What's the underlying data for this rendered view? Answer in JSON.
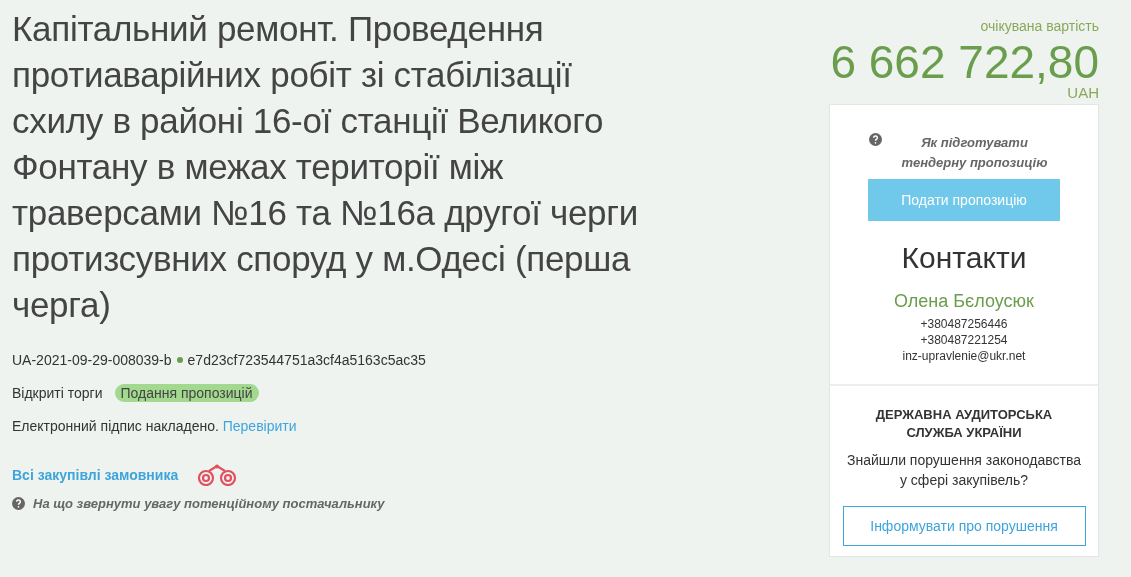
{
  "title": "Капітальний ремонт. Проведення протиаварійних робіт зі стабілізації схилу в районі 16-ої станції Великого Фонтану в межах території між траверсами №16 та №16а другої черги протизсувних споруд у м.Одесі (перша черга)",
  "tender_id": "UA-2021-09-29-008039-b",
  "hash": "e7d23cf723544751a3cf4a5163c5ac35",
  "procedure": "Відкриті торги",
  "status": {
    "label": "Подання пропозицій",
    "color": "#a3d98f"
  },
  "signature": {
    "text": "Електронний підпис накладено.",
    "link": "Перевірити"
  },
  "buyer_link": "Всі закупівлі замовника",
  "supplier_hint": "На що звернути увагу потенційному постачальнику",
  "price": {
    "caption": "очікувана вартість",
    "amount": "6 662 722,80",
    "currency": "UAH"
  },
  "card": {
    "hint": "Як підготувати тендерну пропозицію",
    "submit_button": "Подати пропозицію",
    "contacts_title": "Контакти",
    "contact_name": "Олена Бєлоусюк",
    "phones": [
      "+380487256446",
      "+380487221254"
    ],
    "email": "inz-upravlenie@ukr.net"
  },
  "audit": {
    "title": "ДЕРЖАВНА АУДИТОРСЬКА СЛУЖБА УКРАЇНИ",
    "question": "Знайшли порушення законодавства у сфері закупівель?",
    "button": "Інформувати про порушення"
  }
}
